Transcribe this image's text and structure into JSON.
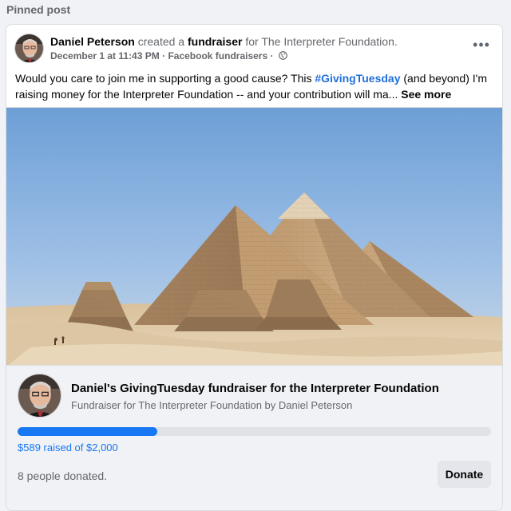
{
  "page": {
    "pinned_label": "Pinned post"
  },
  "post": {
    "author": "Daniel Peterson",
    "action_prefix": "created a",
    "action_object": "fundraiser",
    "action_suffix": "for The Interpreter Foundation.",
    "timestamp": "December 1 at 11:43 PM",
    "source": "Facebook fundraisers",
    "separator": "·",
    "privacy_icon": "globe-icon",
    "more_icon": "more-options-icon",
    "more_label": "•••",
    "text_before_hashtag": "Would you care to join me in supporting a good cause? This ",
    "hashtag": "#GivingTuesday",
    "text_after_hashtag": " (and beyond) I'm raising money for the Interpreter Foundation -- and your contribution will ma...",
    "see_more": "See more"
  },
  "fundraiser": {
    "title": "Daniel's GivingTuesday fundraiser for the Interpreter Foundation",
    "subtitle": "Fundraiser for The Interpreter Foundation by Daniel Peterson",
    "raised_text": "$589 raised of $2,000",
    "raised_amount": 589,
    "goal_amount": 2000,
    "progress_fraction": 0.2945,
    "donors_text": "8 people donated.",
    "donate_label": "Donate"
  },
  "colors": {
    "accent": "#1877f2",
    "hashtag": "#216fdb",
    "muted_text": "#65676b",
    "panel_bg": "#f0f2f5"
  }
}
